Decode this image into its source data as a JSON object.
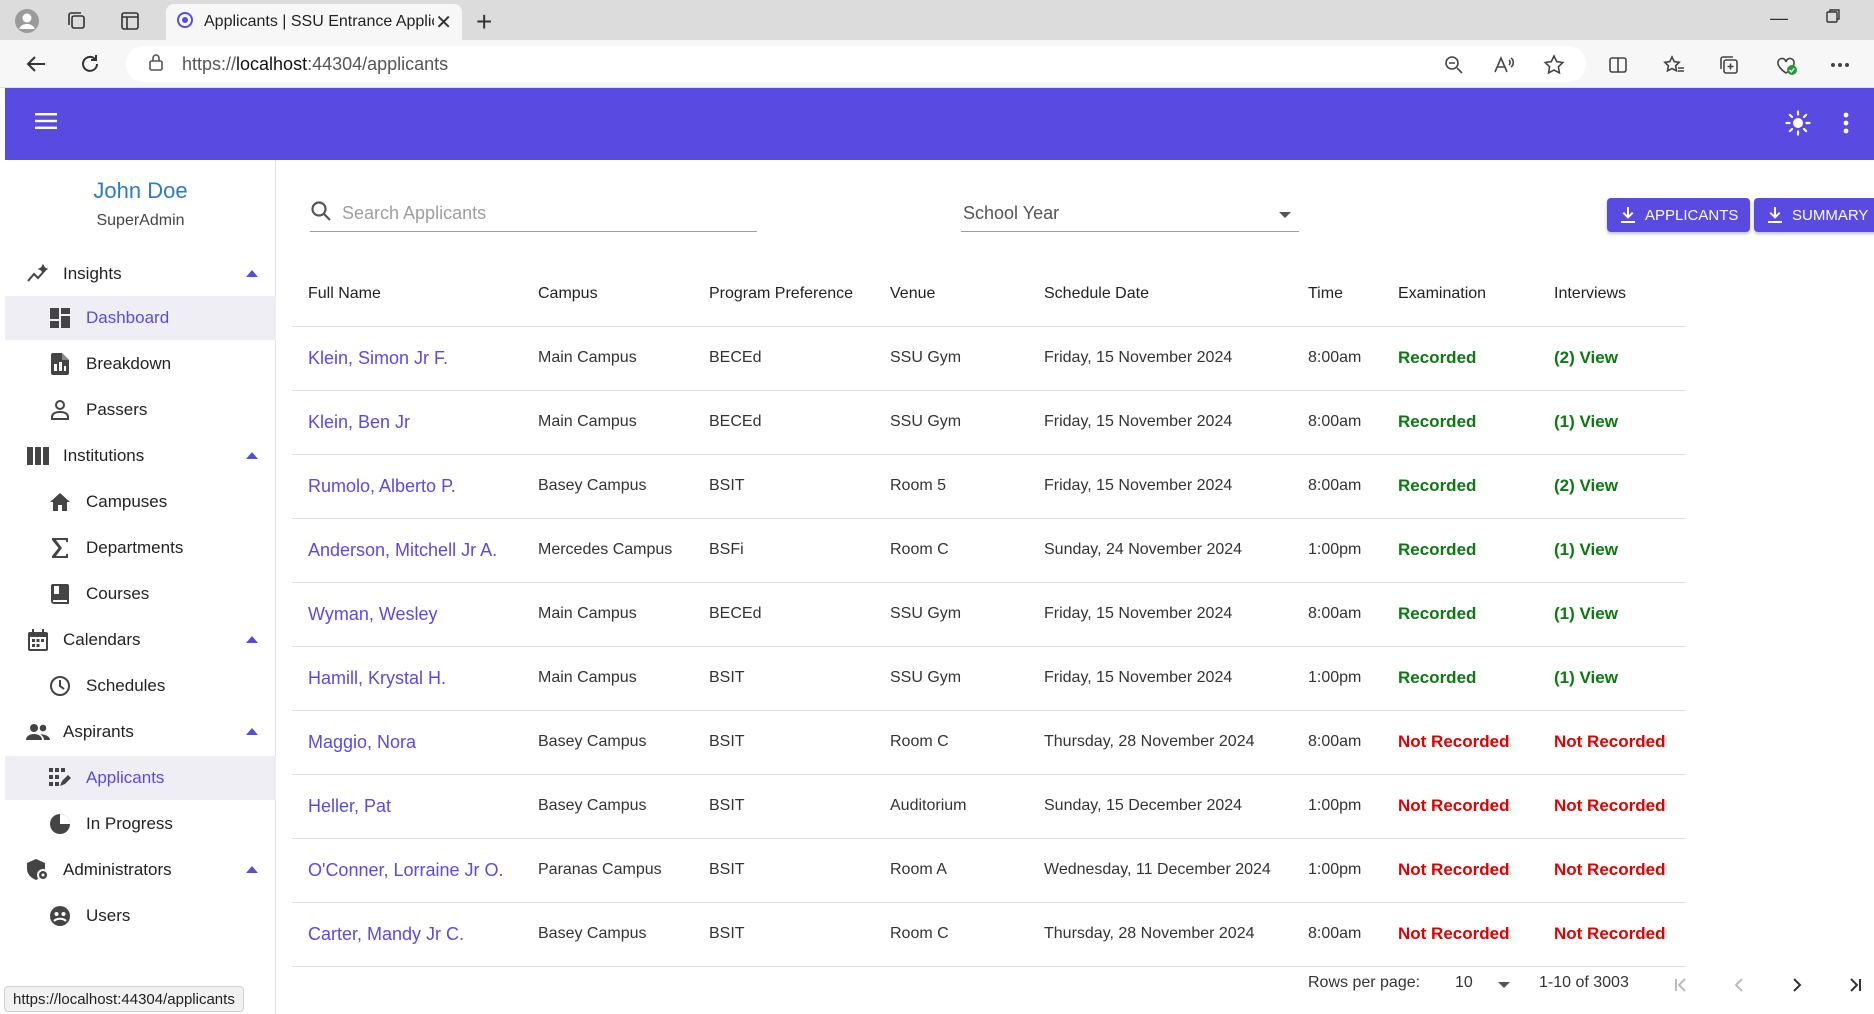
{
  "browser": {
    "tab_title": "Applicants | SSU Entrance Applica",
    "url_scheme": "https://",
    "url_host": "localhost",
    "url_rest": ":44304/applicants",
    "status_url": "https://localhost:44304/applicants"
  },
  "theme": {
    "primary": "#594ae2",
    "recorded": "#0b7a10",
    "not_recorded": "#e00000",
    "link_blue": "#2d7ac8"
  },
  "user": {
    "name": "John Doe",
    "role": "SuperAdmin"
  },
  "nav": {
    "insights": "Insights",
    "dashboard": "Dashboard",
    "breakdown": "Breakdown",
    "passers": "Passers",
    "institutions": "Institutions",
    "campuses": "Campuses",
    "departments": "Departments",
    "courses": "Courses",
    "calendars": "Calendars",
    "schedules": "Schedules",
    "aspirants": "Aspirants",
    "applicants": "Applicants",
    "in_progress": "In Progress",
    "administrators": "Administrators",
    "users": "Users"
  },
  "toolbar": {
    "search_placeholder": "Search Applicants",
    "school_year_label": "School Year",
    "applicants_button": "APPLICANTS",
    "summary_button": "SUMMARY"
  },
  "table": {
    "headers": [
      "Full Name",
      "Campus",
      "Program Preference",
      "Venue",
      "Schedule Date",
      "Time",
      "Examination",
      "Interviews"
    ],
    "rows": [
      {
        "name": "Klein, Simon Jr F.",
        "campus": "Main Campus",
        "program": "BECEd",
        "venue": "SSU Gym",
        "date": "Friday, 15 November 2024",
        "time": "8:00am",
        "exam": "Recorded",
        "interview": "(2) View"
      },
      {
        "name": "Klein, Ben Jr",
        "campus": "Main Campus",
        "program": "BECEd",
        "venue": "SSU Gym",
        "date": "Friday, 15 November 2024",
        "time": "8:00am",
        "exam": "Recorded",
        "interview": "(1) View"
      },
      {
        "name": "Rumolo, Alberto P.",
        "campus": "Basey Campus",
        "program": "BSIT",
        "venue": "Room 5",
        "date": "Friday, 15 November 2024",
        "time": "8:00am",
        "exam": "Recorded",
        "interview": "(2) View"
      },
      {
        "name": "Anderson, Mitchell Jr A.",
        "campus": "Mercedes Campus",
        "program": "BSFi",
        "venue": "Room C",
        "date": "Sunday, 24 November 2024",
        "time": "1:00pm",
        "exam": "Recorded",
        "interview": "(1) View"
      },
      {
        "name": "Wyman, Wesley",
        "campus": "Main Campus",
        "program": "BECEd",
        "venue": "SSU Gym",
        "date": "Friday, 15 November 2024",
        "time": "8:00am",
        "exam": "Recorded",
        "interview": "(1) View"
      },
      {
        "name": "Hamill, Krystal H.",
        "campus": "Main Campus",
        "program": "BSIT",
        "venue": "SSU Gym",
        "date": "Friday, 15 November 2024",
        "time": "1:00pm",
        "exam": "Recorded",
        "interview": "(1) View"
      },
      {
        "name": "Maggio, Nora",
        "campus": "Basey Campus",
        "program": "BSIT",
        "venue": "Room C",
        "date": "Thursday, 28 November 2024",
        "time": "8:00am",
        "exam": "Not Recorded",
        "interview": "Not Recorded"
      },
      {
        "name": "Heller, Pat",
        "campus": "Basey Campus",
        "program": "BSIT",
        "venue": "Auditorium",
        "date": "Sunday, 15 December 2024",
        "time": "1:00pm",
        "exam": "Not Recorded",
        "interview": "Not Recorded"
      },
      {
        "name": "O'Conner, Lorraine Jr O.",
        "campus": "Paranas Campus",
        "program": "BSIT",
        "venue": "Room A",
        "date": "Wednesday, 11 December 2024",
        "time": "1:00pm",
        "exam": "Not Recorded",
        "interview": "Not Recorded"
      },
      {
        "name": "Carter, Mandy Jr C.",
        "campus": "Basey Campus",
        "program": "BSIT",
        "venue": "Room C",
        "date": "Thursday, 28 November 2024",
        "time": "8:00am",
        "exam": "Not Recorded",
        "interview": "Not Recorded"
      }
    ]
  },
  "pagination": {
    "rows_per_page_label": "Rows per page:",
    "rows_per_page": "10",
    "range": "1-10 of 3003"
  }
}
